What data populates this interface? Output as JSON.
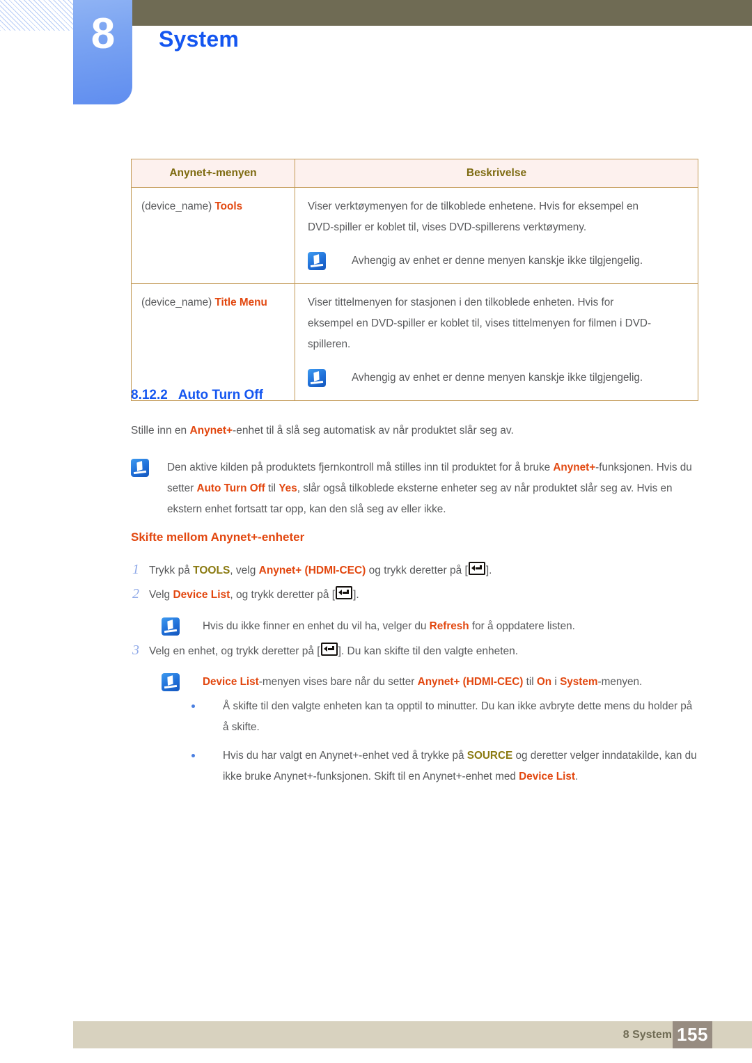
{
  "header": {
    "chapter_number": "8",
    "chapter_title": "System"
  },
  "table": {
    "columns": [
      "Anynet+-menyen",
      "Beskrivelse"
    ],
    "rows": [
      {
        "menu_prefix": "(device_name) ",
        "menu_highlight": "Tools",
        "description_lines": [
          "Viser verktøymenyen for de tilkoblede enhetene. Hvis for eksempel en",
          "DVD-spiller er koblet til, vises DVD-spillerens verktøymeny."
        ],
        "note": "Avhengig av enhet er denne menyen kanskje ikke tilgjengelig."
      },
      {
        "menu_prefix": "(device_name) ",
        "menu_highlight": "Title Menu",
        "description_lines": [
          "Viser tittelmenyen for stasjonen i den tilkoblede enheten. Hvis for",
          "eksempel en DVD-spiller er koblet til, vises tittelmenyen for filmen i DVD-",
          "spilleren."
        ],
        "note": "Avhengig av enhet er denne menyen kanskje ikke tilgjengelig."
      }
    ]
  },
  "section": {
    "number": "8.12.2",
    "title": "Auto Turn Off",
    "intro_a": "Stille inn en ",
    "intro_hl": "Anynet+",
    "intro_b": "-enhet til å slå seg automatisk av når produktet slår seg av."
  },
  "note_main": {
    "line1_a": "Den aktive kilden på produktets fjernkontroll må stilles inn til produktet for å bruke ",
    "line1_hl": "Anynet+",
    "line1_b": "-funksjonen.",
    "line2_a": "Hvis du setter ",
    "line2_hl1": "Auto Turn Off",
    "line2_b": " til ",
    "line2_hl2": "Yes",
    "line2_c": ", slår også tilkoblede eksterne enheter seg av når produktet slår seg",
    "line3": "av. Hvis en ekstern enhet fortsatt tar opp, kan den slå seg av eller ikke."
  },
  "subsection": {
    "title": "Skifte mellom Anynet+-enheter"
  },
  "steps": [
    {
      "number": "1",
      "part_a": "Trykk på ",
      "hl_olive": "TOOLS",
      "part_b": ", velg ",
      "hl_orange": "Anynet+ (HDMI-CEC)",
      "part_c": " og trykk deretter på [",
      "part_d": "]."
    },
    {
      "number": "2",
      "part_a": "Velg ",
      "hl_orange": "Device List",
      "part_b": ", og trykk deretter på [",
      "part_c": "]."
    },
    {
      "number": "3",
      "part_a": "Velg en enhet, og trykk deretter på [",
      "part_b": "]. Du kan skifte til den valgte enheten."
    }
  ],
  "note_step2": {
    "part_a": "Hvis du ikke finner en enhet du vil ha, velger du ",
    "hl": "Refresh",
    "part_b": " for å oppdatere listen."
  },
  "note_step3": {
    "hl1": "Device List",
    "part_a": "-menyen vises bare når du setter ",
    "hl2": "Anynet+ (HDMI-CEC)",
    "part_b": " til ",
    "hl3": "On",
    "part_c": " i ",
    "hl4": "System",
    "part_d": "-menyen."
  },
  "bullets": [
    {
      "lines": [
        "Å skifte til den valgte enheten kan ta opptil to minutter. Du kan ikke avbryte dette mens du",
        "holder på å skifte."
      ]
    },
    {
      "line1_a": "Hvis du har valgt en Anynet+-enhet ved å trykke på ",
      "line1_hl": "SOURCE",
      "line1_b": " og deretter velger inndatakilde,",
      "line2_a": "kan du ikke bruke Anynet+-funksjonen. Skift til en Anynet+-enhet med ",
      "line2_hl": "Device List",
      "line2_b": "."
    }
  ],
  "footer": {
    "label": "8 System",
    "page": "155"
  },
  "colors": {
    "accent_blue": "#1456f0",
    "accent_orange": "#e2470f",
    "accent_olive": "#8a7a11",
    "olive_bar": "#6f6b54",
    "footer_bar": "#d8d2bf",
    "page_box": "#978c81",
    "table_header_bg": "#fdf1ee",
    "table_border": "#c39a56"
  }
}
